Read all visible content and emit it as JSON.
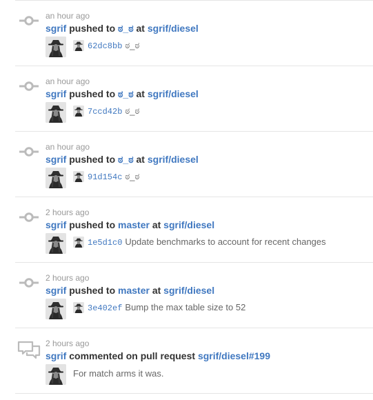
{
  "events": [
    {
      "type": "push",
      "icon": "git-commit-icon",
      "time": "an hour ago",
      "actor": "sgrif",
      "action": "pushed to",
      "target": "ಠ_ಠ",
      "preposition": "at",
      "repo": "sgrif/diesel",
      "commit_sha": "62dc8bb",
      "commit_message": "ಠ_ಠ"
    },
    {
      "type": "push",
      "icon": "git-commit-icon",
      "time": "an hour ago",
      "actor": "sgrif",
      "action": "pushed to",
      "target": "ಠ_ಠ",
      "preposition": "at",
      "repo": "sgrif/diesel",
      "commit_sha": "7ccd42b",
      "commit_message": "ಠ_ಠ"
    },
    {
      "type": "push",
      "icon": "git-commit-icon",
      "time": "an hour ago",
      "actor": "sgrif",
      "action": "pushed to",
      "target": "ಠ_ಠ",
      "preposition": "at",
      "repo": "sgrif/diesel",
      "commit_sha": "91d154c",
      "commit_message": "ಠ_ಠ"
    },
    {
      "type": "push",
      "icon": "git-commit-icon",
      "time": "2 hours ago",
      "actor": "sgrif",
      "action": "pushed to",
      "target": "master",
      "preposition": "at",
      "repo": "sgrif/diesel",
      "commit_sha": "1e5d1c0",
      "commit_message": "Update benchmarks to account for recent changes"
    },
    {
      "type": "push",
      "icon": "git-commit-icon",
      "time": "2 hours ago",
      "actor": "sgrif",
      "action": "pushed to",
      "target": "master",
      "preposition": "at",
      "repo": "sgrif/diesel",
      "commit_sha": "3e402ef",
      "commit_message": "Bump the max table size to 52"
    },
    {
      "type": "comment",
      "icon": "comment-discussion-icon",
      "time": "2 hours ago",
      "actor": "sgrif",
      "action": "commented on pull request",
      "target": "sgrif/diesel#199",
      "comment": "For match arms it was."
    }
  ],
  "colors": {
    "link": "#4078c0",
    "muted": "#999999",
    "icon": "#bbbbbb",
    "divider": "#e5e5e5"
  }
}
